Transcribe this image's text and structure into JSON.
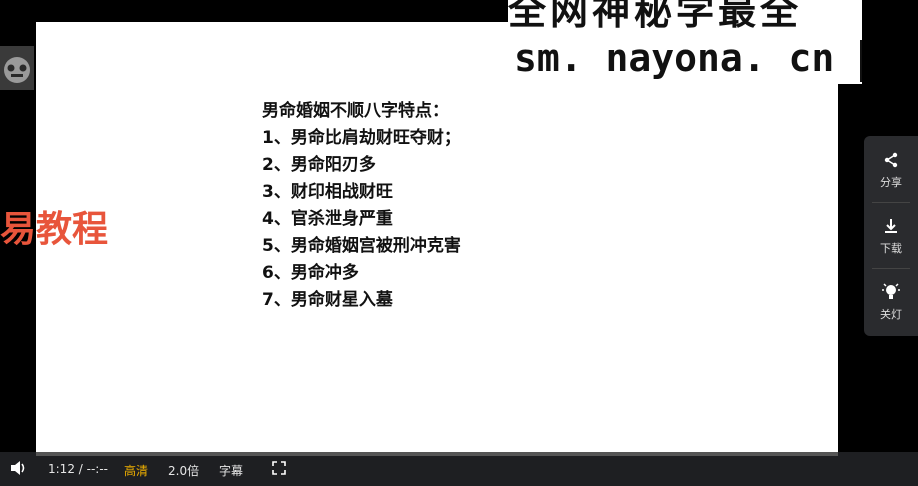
{
  "watermark": {
    "line1": "全网神秘学最全",
    "url": "sm. nayona. cn"
  },
  "brand": {
    "text": "易教程"
  },
  "slide": {
    "title": "男命婚姻不顺八字特点：",
    "items": [
      "1、男命比肩劫财旺夺财；",
      "2、男命阳刃多",
      "3、财印相战财旺",
      "4、官杀泄身严重",
      "5、男命婚姻宫被刑冲克害",
      "6、男命冲多",
      "7、男命财星入墓"
    ]
  },
  "side": {
    "share": "分享",
    "download": "下载",
    "lights": "关灯"
  },
  "player": {
    "time": "1:12 / --:--",
    "quality": "高清",
    "speed": "2.0倍",
    "subtitle": "字幕"
  },
  "colors": {
    "brand": "#e8553b",
    "highlight": "#f0b000"
  }
}
